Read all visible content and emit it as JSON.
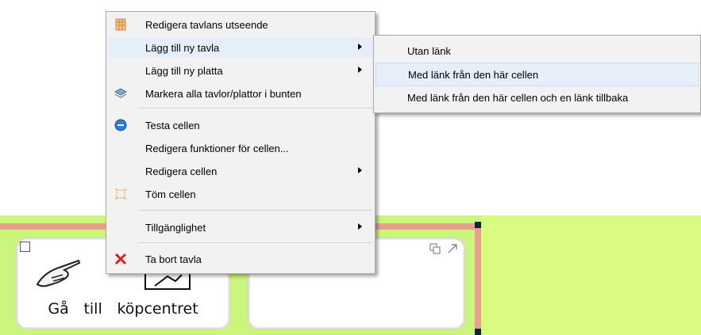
{
  "context_menu": {
    "items": [
      {
        "label": "Redigera tavlans utseende",
        "icon": "board-grid-icon",
        "submenu": false
      },
      {
        "label": "Lägg till ny tavla",
        "icon": "",
        "submenu": true
      },
      {
        "label": "Lägg till ny platta",
        "icon": "",
        "submenu": true
      },
      {
        "label": "Markera alla tavlor/plattor i bunten",
        "icon": "stack-layers-icon",
        "submenu": false
      },
      {
        "label": "Testa cellen",
        "icon": "test-cell-icon",
        "submenu": false
      },
      {
        "label": "Redigera funktioner för cellen...",
        "icon": "",
        "submenu": false
      },
      {
        "label": "Redigera cellen",
        "icon": "",
        "submenu": true
      },
      {
        "label": "Töm cellen",
        "icon": "empty-cell-icon",
        "submenu": false
      },
      {
        "label": "Tillgänglighet",
        "icon": "",
        "submenu": true
      },
      {
        "label": "Ta bort tavla",
        "icon": "delete-x-icon",
        "submenu": false
      }
    ]
  },
  "submenu": {
    "items": [
      {
        "label": "Utan länk"
      },
      {
        "label": "Med länk från den här cellen"
      },
      {
        "label": "Med länk från den här cellen och en länk tillbaka"
      }
    ]
  },
  "board": {
    "cell1": {
      "words": [
        "Gå",
        "till",
        "köpcentret"
      ],
      "icon": "pointing-hand-icon"
    },
    "cell2": {
      "icons": [
        "copy-icon",
        "expand-arrow-icon"
      ]
    }
  },
  "colors": {
    "board_bg": "#ccf57e",
    "cell_border": "#e8a08c",
    "menu_bg": "#f2f2f2",
    "hover_bg": "#e5eef9",
    "delete_red": "#e02020"
  }
}
